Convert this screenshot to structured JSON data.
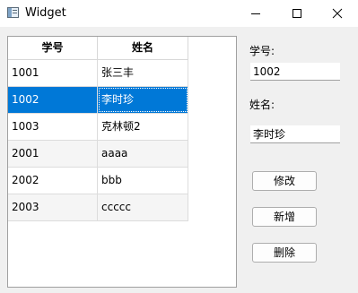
{
  "window": {
    "title": "Widget",
    "controls": {
      "minimize_icon": "minimize-icon",
      "maximize_icon": "maximize-icon",
      "close_icon": "close-icon"
    }
  },
  "table": {
    "columns": [
      "学号",
      "姓名"
    ],
    "rows": [
      [
        "1001",
        "张三丰"
      ],
      [
        "1002",
        "李时珍"
      ],
      [
        "1003",
        "克林顿2"
      ],
      [
        "2001",
        "aaaa"
      ],
      [
        "2002",
        "bbb"
      ],
      [
        "2003",
        "ccccc"
      ]
    ],
    "selected_row": 1
  },
  "form": {
    "id_label": "学号:",
    "id_value": "1002",
    "name_label": "姓名:",
    "name_value": "李时珍"
  },
  "buttons": {
    "modify": "修改",
    "add": "新增",
    "delete": "删除"
  },
  "colors": {
    "selection": "#0078d7",
    "window_bg": "#f0f0f0"
  }
}
